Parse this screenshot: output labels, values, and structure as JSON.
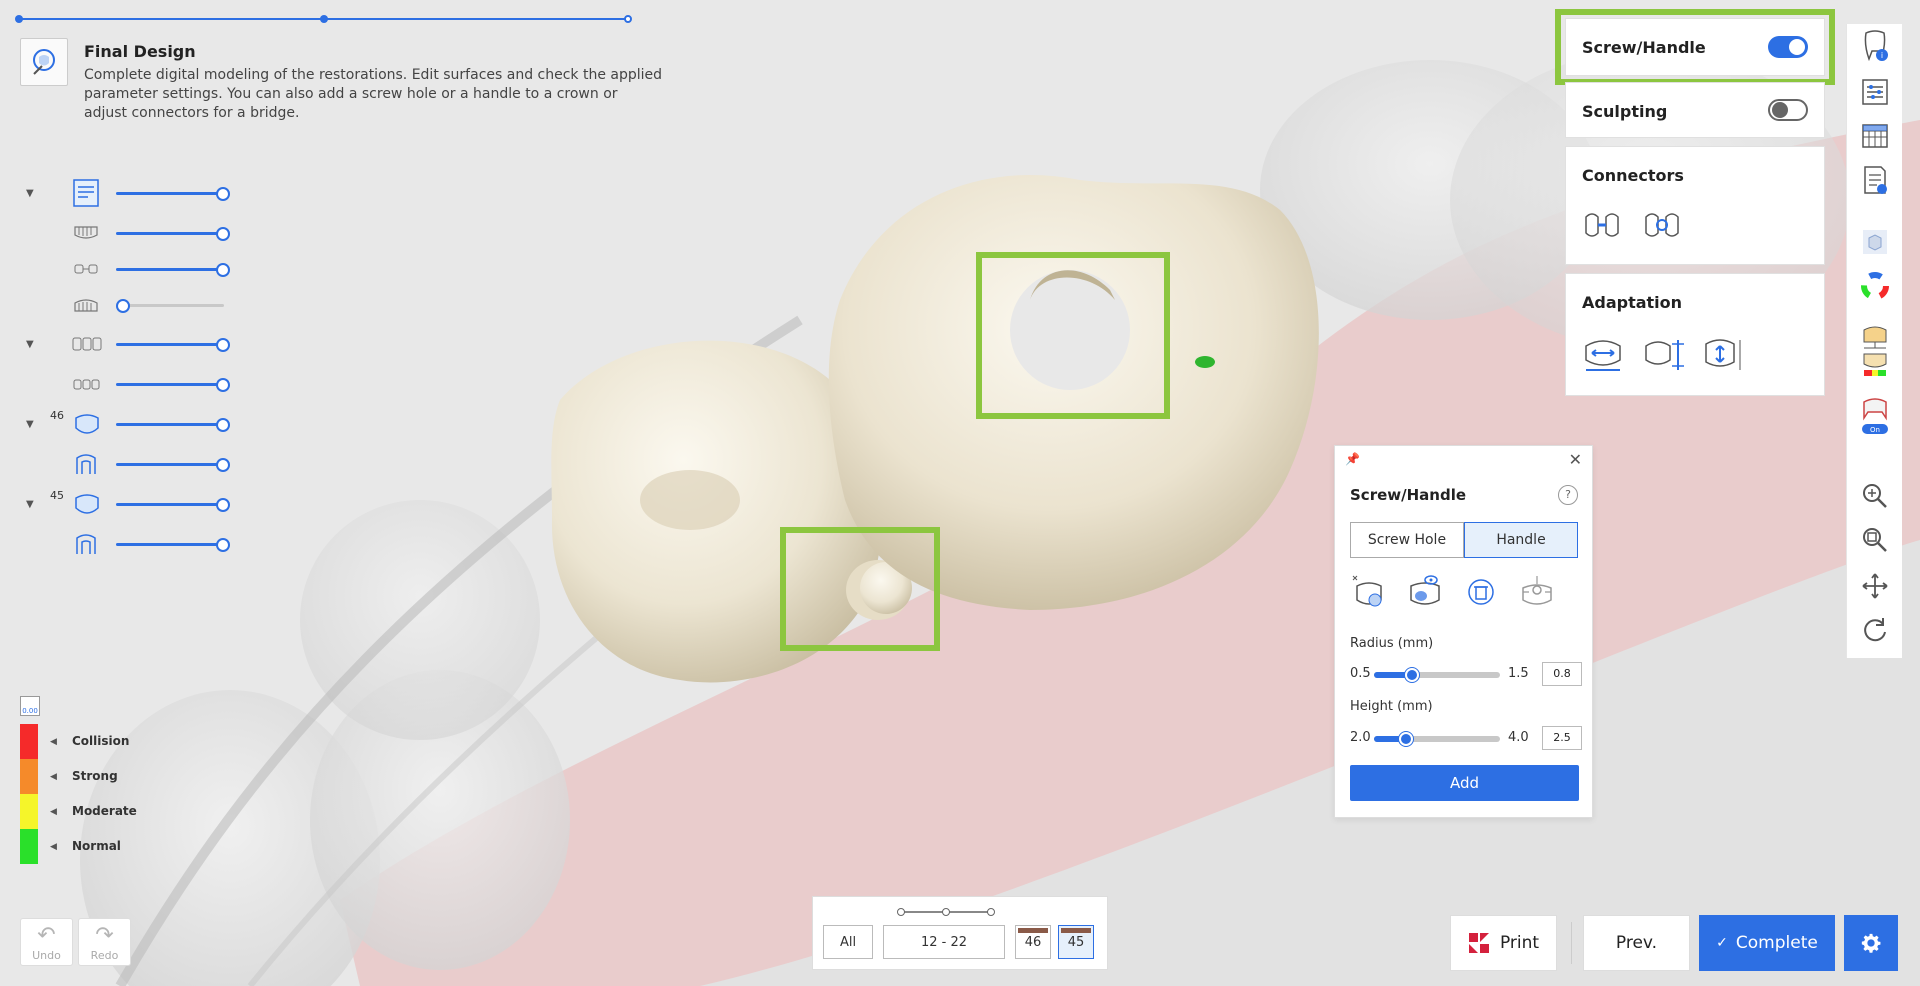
{
  "header": {
    "title": "Final Design",
    "description": "Complete digital modeling of the restorations. Edit surfaces and check the applied parameter settings. You can also add a screw hole or a handle to a crown or adjust connectors for a bridge."
  },
  "object_list": [
    {
      "icon": "scan-data-icon",
      "expand": true,
      "number": "",
      "level": 1.0
    },
    {
      "icon": "upper-jaw-icon",
      "expand": false,
      "number": "",
      "level": 1.0
    },
    {
      "icon": "abutment-icon",
      "expand": false,
      "number": "",
      "level": 1.0
    },
    {
      "icon": "lower-jaw-icon",
      "expand": false,
      "number": "",
      "level": 0.0
    },
    {
      "icon": "bridge-group-icon",
      "expand": true,
      "number": "",
      "level": 1.0
    },
    {
      "icon": "connector-icon",
      "expand": false,
      "number": "",
      "level": 1.0
    },
    {
      "icon": "crown-icon",
      "expand": true,
      "number": "46",
      "level": 1.0
    },
    {
      "icon": "prep-icon",
      "expand": false,
      "number": "",
      "level": 1.0
    },
    {
      "icon": "crown-icon",
      "expand": true,
      "number": "45",
      "level": 1.0
    },
    {
      "icon": "prep-icon",
      "expand": false,
      "number": "",
      "level": 1.0
    }
  ],
  "legend": {
    "top_value": "0.00",
    "items": [
      {
        "label": "Collision",
        "color": "#f52a2a"
      },
      {
        "label": "Strong",
        "color": "#f58a2a"
      },
      {
        "label": "Moderate",
        "color": "#f5f52a"
      },
      {
        "label": "Normal",
        "color": "#2ae02a"
      }
    ]
  },
  "undo": {
    "label": "Undo"
  },
  "redo": {
    "label": "Redo"
  },
  "tooth_selector": {
    "all_label": "All",
    "range_label": "12 - 22",
    "teeth": [
      "46",
      "45"
    ],
    "selected": "45"
  },
  "actions": {
    "print_label": "Print",
    "prev_label": "Prev.",
    "complete_label": "Complete"
  },
  "panels": {
    "screw_handle": {
      "title": "Screw/Handle",
      "enabled": true
    },
    "sculpting": {
      "title": "Sculpting",
      "enabled": false
    },
    "connectors": {
      "title": "Connectors"
    },
    "adaptation": {
      "title": "Adaptation"
    }
  },
  "dialog": {
    "title": "Screw/Handle",
    "help": "?",
    "tabs": [
      "Screw Hole",
      "Handle"
    ],
    "selected_tab": "Handle",
    "radius": {
      "label": "Radius (mm)",
      "min": "0.5",
      "max": "1.5",
      "value": "0.8",
      "fraction": 0.3
    },
    "height": {
      "label": "Height (mm)",
      "min": "2.0",
      "max": "4.0",
      "value": "2.5",
      "fraction": 0.25
    },
    "add_label": "Add"
  },
  "colors": {
    "accent": "#2d6fe3",
    "highlight": "#8cc63f"
  }
}
